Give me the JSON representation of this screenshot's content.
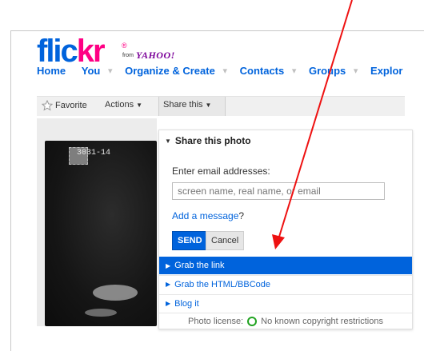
{
  "header": {
    "logo_text_a": "flic",
    "logo_text_b": "kr",
    "logo_reg": "®",
    "logo_from": "from",
    "logo_yahoo": "YAHOO!"
  },
  "nav": {
    "home": "Home",
    "you": "You",
    "organize": "Organize & Create",
    "contacts": "Contacts",
    "groups": "Groups",
    "explore": "Explor",
    "caret": "▾"
  },
  "toolbar": {
    "favorite": "Favorite",
    "actions": "Actions",
    "share": "Share this",
    "caret": "▼"
  },
  "photo": {
    "label": "3031-14"
  },
  "share_panel": {
    "title": "Share this photo",
    "email_label": "Enter email addresses:",
    "email_placeholder": "screen name, real name, or email",
    "email_value": "",
    "add_message": "Add a message",
    "add_message_q": "?",
    "send": "SEND",
    "cancel": "Cancel",
    "rows": [
      {
        "label": "Grab the link"
      },
      {
        "label": "Grab the HTML/BBCode"
      },
      {
        "label": "Blog it"
      }
    ],
    "license_prefix": "Photo license:",
    "license_text": "No known copyright restrictions"
  },
  "colors": {
    "flickr_blue": "#0063dc",
    "flickr_pink": "#ff0084",
    "annotation_red": "#ee1111",
    "license_green": "#22a322"
  }
}
